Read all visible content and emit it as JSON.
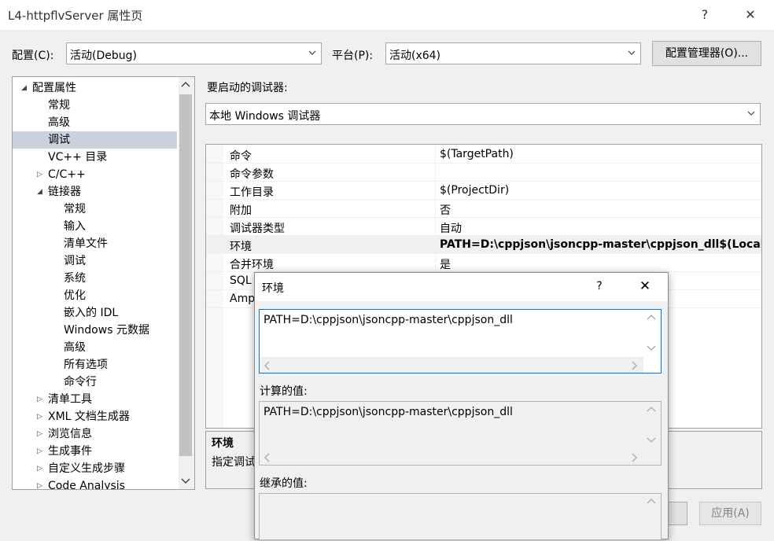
{
  "window": {
    "title": "L4-httpflvServer 属性页",
    "help": "?",
    "close": "✕"
  },
  "toolbar": {
    "config_label": "配置(C):",
    "config_value": "活动(Debug)",
    "platform_label": "平台(P):",
    "platform_value": "活动(x64)",
    "config_manager": "配置管理器(O)..."
  },
  "tree": {
    "items": [
      {
        "label": "配置属性",
        "level": 0,
        "expander": "open"
      },
      {
        "label": "常规",
        "level": 1
      },
      {
        "label": "高级",
        "level": 1
      },
      {
        "label": "调试",
        "level": 1,
        "selected": true
      },
      {
        "label": "VC++ 目录",
        "level": 1
      },
      {
        "label": "C/C++",
        "level": 1,
        "expander": "closed"
      },
      {
        "label": "链接器",
        "level": 1,
        "expander": "open"
      },
      {
        "label": "常规",
        "level": 2
      },
      {
        "label": "输入",
        "level": 2
      },
      {
        "label": "清单文件",
        "level": 2
      },
      {
        "label": "调试",
        "level": 2
      },
      {
        "label": "系统",
        "level": 2
      },
      {
        "label": "优化",
        "level": 2
      },
      {
        "label": "嵌入的 IDL",
        "level": 2
      },
      {
        "label": "Windows 元数据",
        "level": 2
      },
      {
        "label": "高级",
        "level": 2
      },
      {
        "label": "所有选项",
        "level": 2
      },
      {
        "label": "命令行",
        "level": 2
      },
      {
        "label": "清单工具",
        "level": 1,
        "expander": "closed"
      },
      {
        "label": "XML 文档生成器",
        "level": 1,
        "expander": "closed"
      },
      {
        "label": "浏览信息",
        "level": 1,
        "expander": "closed"
      },
      {
        "label": "生成事件",
        "level": 1,
        "expander": "closed"
      },
      {
        "label": "自定义生成步骤",
        "level": 1,
        "expander": "closed"
      },
      {
        "label": "Code Analysis",
        "level": 1,
        "expander": "closed"
      }
    ]
  },
  "debugger": {
    "label": "要启动的调试器:",
    "value": "本地 Windows 调试器"
  },
  "grid": {
    "rows": [
      {
        "key": "命令",
        "value": "$(TargetPath)"
      },
      {
        "key": "命令参数",
        "value": ""
      },
      {
        "key": "工作目录",
        "value": "$(ProjectDir)"
      },
      {
        "key": "附加",
        "value": "否"
      },
      {
        "key": "调试器类型",
        "value": "自动"
      },
      {
        "key": "环境",
        "value": "PATH=D:\\cppjson\\jsoncpp-master\\cppjson_dll$(LocalD",
        "bold": true,
        "selected": true
      },
      {
        "key": "合并环境",
        "value": "是"
      },
      {
        "key": "SQL",
        "value": ""
      },
      {
        "key": "Amp",
        "value": ""
      }
    ]
  },
  "description": {
    "title": "环境",
    "text": "指定调试"
  },
  "apply_button": "应用(A)",
  "dialog": {
    "title": "环境",
    "help": "?",
    "close": "✕",
    "edit_value": "PATH=D:\\cppjson\\jsoncpp-master\\cppjson_dll",
    "computed_label": "计算的值:",
    "computed_value": "PATH=D:\\cppjson\\jsoncpp-master\\cppjson_dll",
    "inherited_label": "继承的值:"
  }
}
